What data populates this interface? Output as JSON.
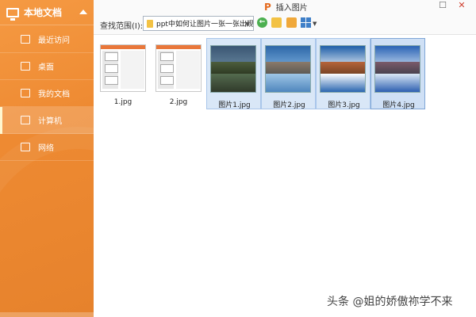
{
  "sidebar": {
    "header": "本地文档",
    "items": [
      {
        "label": "最近访问"
      },
      {
        "label": "桌面"
      },
      {
        "label": "我的文档"
      },
      {
        "label": "计算机"
      },
      {
        "label": "网络"
      }
    ]
  },
  "window": {
    "title": "插入图片",
    "logo": "P"
  },
  "toolbar": {
    "scope_label": "查找范围(I):",
    "path_value": "ppt中如何让图片一张一张出现"
  },
  "files": [
    {
      "name": "1.jpg",
      "selected": false
    },
    {
      "name": "2.jpg",
      "selected": false
    },
    {
      "name": "图片1.jpg",
      "selected": true
    },
    {
      "name": "图片2.jpg",
      "selected": true
    },
    {
      "name": "图片3.jpg",
      "selected": true
    },
    {
      "name": "图片4.jpg",
      "selected": true
    }
  ],
  "watermark": "头条 @姐的娇傲祢学不来",
  "colors": {
    "sidebar": "#ee8a32",
    "selection": "#d9e7f7",
    "accent": "#e46a1e"
  }
}
